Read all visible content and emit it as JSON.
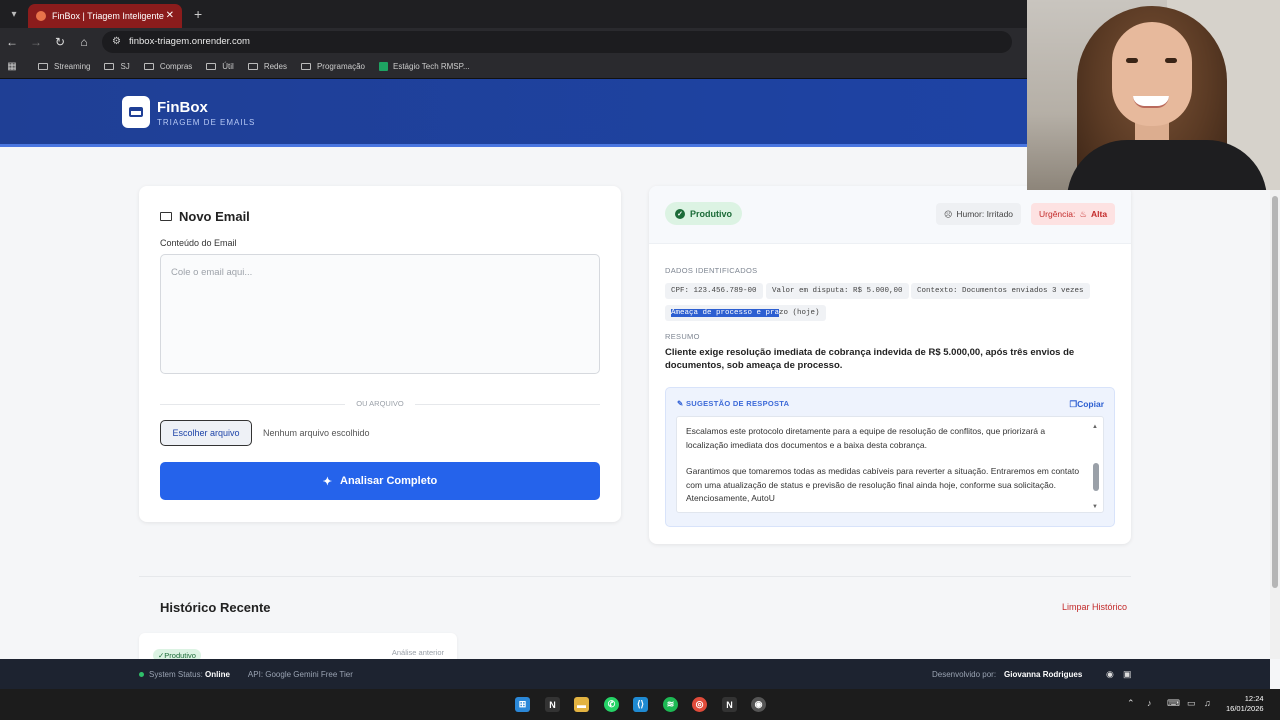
{
  "browser": {
    "tab_title": "FinBox | Triagem Inteligente",
    "tab_close": "✕",
    "new_tab": "+",
    "url": "finbox-triagem.onrender.com",
    "bookmarks": [
      "Streaming",
      "SJ",
      "Compras",
      "Útil",
      "Redes",
      "Programação",
      "Estágio Tech RMSP..."
    ]
  },
  "header": {
    "brand": "FinBox",
    "subtitle": "TRIAGEM DE EMAILS"
  },
  "form": {
    "title": "Novo Email",
    "content_label": "Conteúdo do Email",
    "placeholder": "Cole o email aqui...",
    "divider": "OU ARQUIVO",
    "choose_file": "Escolher arquivo",
    "no_file": "Nenhum arquivo escolhido",
    "analyze": "Analisar Completo"
  },
  "result": {
    "category": "Produtivo",
    "humor_label": "Humor: Irritado",
    "urgency_label": "Urgência:",
    "urgency_value": "Alta",
    "data_title": "DADOS IDENTIFICADOS",
    "chips": {
      "cpf": "CPF: 123.456.789-00",
      "valor": "Valor em disputa: R$ 5.000,00",
      "contexto": "Contexto: Documentos enviados 3 vezes",
      "ameaca_sel": "Ameaça de processo e pra",
      "ameaca_rest": "zo (hoje)"
    },
    "summary_title": "RESUMO",
    "summary": "Cliente exige resolução imediata de cobrança indevida de R$ 5.000,00, após três envios de documentos, sob ameaça de processo.",
    "suggestion_title": "SUGESTÃO DE RESPOSTA",
    "copy": "Copiar",
    "suggestion_p1": "Escalamos este protocolo diretamente para a equipe de resolução de conflitos, que priorizará a localização imediata dos documentos e a baixa desta cobrança.",
    "suggestion_p2": "Garantimos que tomaremos todas as medidas cabíveis para reverter a situação. Entraremos em contato com uma atualização de status e previsão de resolução final ainda hoje, conforme sua solicitação. Atenciosamente, AutoU"
  },
  "history": {
    "title": "Histórico Recente",
    "clear": "Limpar Histórico",
    "item_badge": "Produtivo",
    "item_meta": "Análise anterior"
  },
  "footer": {
    "status_prefix": "System Status:",
    "status_value": "Online",
    "api": "API: Google Gemini Free Tier",
    "dev_prefix": "Desenvolvido por:",
    "dev_name": "Giovanna Rodrigues"
  },
  "taskbar": {
    "time": "12:24",
    "date": "16/01/2026"
  },
  "colors": {
    "header_blue": "#1f3f95",
    "primary_button": "#2563eb",
    "productive_green": "#1c6b38",
    "urgency_red": "#c32a2a"
  }
}
